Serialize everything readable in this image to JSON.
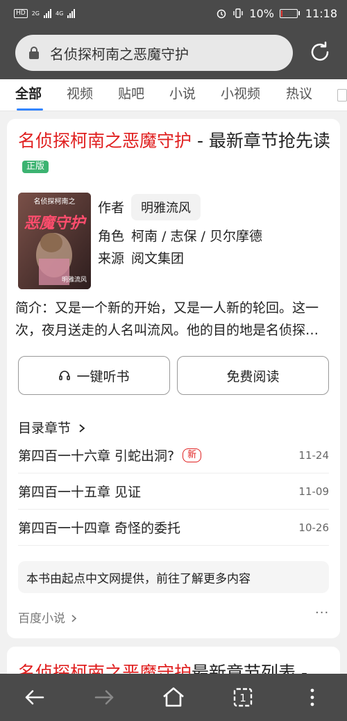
{
  "status_bar": {
    "hd_label": "HD",
    "net_1": "2G",
    "net_2": "4G",
    "battery_percent": "10%",
    "time": "11:18",
    "battery_level": 0.1
  },
  "url_bar": {
    "query": "名侦探柯南之恶魔守护",
    "icons": [
      "lock-icon",
      "refresh-icon"
    ]
  },
  "tabs": [
    "全部",
    "视频",
    "贴吧",
    "小说",
    "小视频",
    "热议"
  ],
  "active_tab": 0,
  "result": {
    "title_red": "名侦探柯南之恶魔守护",
    "title_rest": " - 最新章节抢先读",
    "badge": "正版",
    "cover": {
      "top_text": "名侦探柯南之",
      "main_text": "恶魔守护",
      "author_text": "明雅流风"
    },
    "author_label": "作者",
    "author": "明雅流风",
    "role_label": "角色",
    "roles": "柯南 / 志保 / 贝尔摩德",
    "source_label": "来源",
    "source_value": "阅文集团",
    "summary": "简介：又是一个新的开始，又是一人新的轮回。这一次，夜月送走的人名叫流风。他的目的地是名侦探…",
    "listen_button": "一键听书",
    "read_button": "免费阅读",
    "toc_label": "目录章节",
    "chapters": [
      {
        "title": "第四百一十六章 引蛇出洞?",
        "tag": "新",
        "date": "11-24"
      },
      {
        "title": "第四百一十五章 见证",
        "tag": "",
        "date": "11-09"
      },
      {
        "title": "第四百一十四章 奇怪的委托",
        "tag": "",
        "date": "10-26"
      }
    ],
    "notice": "本书由起点中文网提供，前往了解更多内容",
    "provider": "百度小说",
    "more": "···"
  },
  "result2": {
    "title_red": "名侦探柯南之恶魔守护",
    "title_rest": "最新章节列表 -"
  },
  "colors": {
    "accent": "#e02020",
    "tab_underline": "#3385ff",
    "badge_green": "#3cb371",
    "bars": "#4a4a4a"
  }
}
